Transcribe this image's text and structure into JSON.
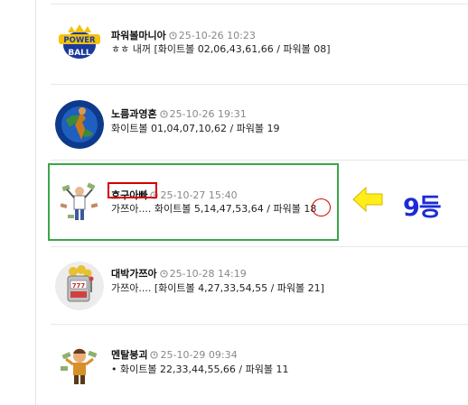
{
  "comments": [
    {
      "name": "파워볼마니아",
      "datetime": "25-10-26 10:23",
      "text": "ㅎㅎ 내꺼 [화이트볼 02,06,43,61,66 / 파워볼 08]",
      "avatar": "powerball-logo"
    },
    {
      "name": "노름과영혼",
      "datetime": "25-10-26 19:31",
      "text": "화이트볼 01,04,07,10,62 / 파워볼 19",
      "avatar": "globe-figure"
    },
    {
      "name": "호구아빠",
      "datetime": "25-10-27 15:40",
      "text": "가쯔아.... 화이트볼 5,14,47,53,64 / 파워볼 18",
      "avatar": "money-rain-man"
    },
    {
      "name": "대박가쯔아",
      "datetime": "25-10-28 14:19",
      "text": "가쯔아.... [화이트볼 4,27,33,54,55 / 파워볼 21]",
      "avatar": "slot-machine"
    },
    {
      "name": "멘탈붕괴",
      "datetime": "25-10-29 09:34",
      "text": "• 화이트볼 22,33,44,55,66 / 파워볼 11",
      "avatar": "money-cartoon-man"
    }
  ],
  "annotation": {
    "rank_label": "9등",
    "arrow": "left-arrow-icon",
    "highlight_color": "#3aa64a",
    "mark_color": "#d40000",
    "rank_color": "#1a2bd6"
  }
}
